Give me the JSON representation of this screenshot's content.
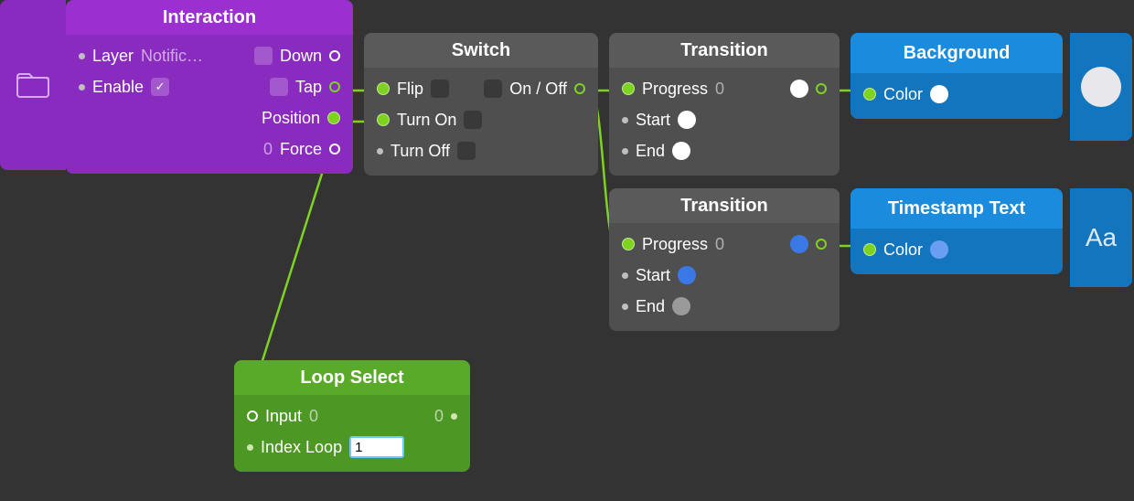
{
  "interaction": {
    "title": "Interaction",
    "layer_label": "Layer",
    "layer_value": "Notific…",
    "enable_label": "Enable",
    "enable_checked": "✓",
    "down_label": "Down",
    "tap_label": "Tap",
    "position_label": "Position",
    "force_label": "Force",
    "force_value": "0"
  },
  "switch": {
    "title": "Switch",
    "flip_label": "Flip",
    "onoff_label": "On / Off",
    "turnon_label": "Turn On",
    "turnoff_label": "Turn Off"
  },
  "transition1": {
    "title": "Transition",
    "progress_label": "Progress",
    "progress_value": "0",
    "start_label": "Start",
    "start_color": "#ffffff",
    "end_label": "End",
    "end_color": "#ffffff",
    "out_color": "#ffffff"
  },
  "transition2": {
    "title": "Transition",
    "progress_label": "Progress",
    "progress_value": "0",
    "start_label": "Start",
    "start_color": "#3a78e6",
    "end_label": "End",
    "end_color": "#9a9a9a",
    "out_color": "#3a78e6"
  },
  "background": {
    "title": "Background",
    "color_label": "Color",
    "color_value": "#ffffff",
    "preview": "#e8e8ec"
  },
  "timestamp": {
    "title": "Timestamp Text",
    "color_label": "Color",
    "color_value": "#6a9ef2",
    "preview_glyph": "Aa"
  },
  "loop": {
    "title": "Loop Select",
    "input_label": "Input",
    "input_value": "0",
    "input_out": "0",
    "index_label": "Index Loop",
    "index_value": "1"
  }
}
